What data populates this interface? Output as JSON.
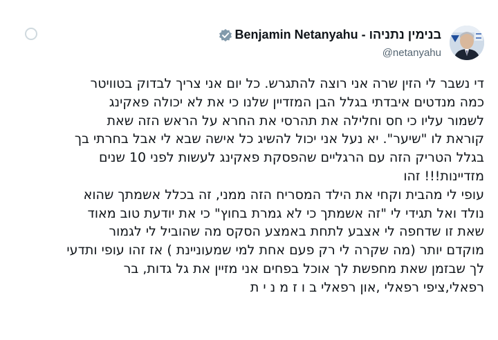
{
  "author": {
    "display_name": "Benjamin Netanyahu - בנימין נתניהו",
    "handle": "@netanyahu",
    "verified_icon": "verified-badge-icon",
    "avatar_icon": "profile-photo"
  },
  "tweet": {
    "lines": [
      "די נשבר לי הזין שרה אני רוצה להתגרש. כל יום אני צריך לבדוק בטוויטר",
      "כמה מנדטים איבדתי בגלל הבן המזדיין שלנו כי את לא יכולה פאקינג",
      "לשמור עליו כי חס וחלילה את תהרסי את החרא על הראש הזה שאת",
      "קוראת לו \"שיער\". יא נעל אני יכול להשיג כל אישה שבא לי אבל בחרתי בך",
      "בגלל הטריק הזה עם הרגליים שהפסקת פאקינג לעשות לפני 10 שנים",
      "מזדיינות!!! זהו",
      "עופי לי מהבית וקחי את הילד המסריח הזה ממני, זה בכלל אשמתך שהוא",
      "נולד ואל תגידי לי \"זה אשמתך כי לא גמרת בחוץ\" כי את יודעת טוב מאוד",
      "שאת זו שדחפה לי אצבע לתחת באמצע הסקס מה שהוביל לי לגמור",
      "מוקדם יותר (מה שקרה לי רק פעם אחת למי שמעוניינת ) אז זהו עופי ותדעי",
      "לך שבזמן שאת מחפשת לך אוכל בפחים אני מזיין את גל גדות, בר",
      "רפאלי,ציפי רפאלי ,און רפאלי ב ו ז מ נ י ת"
    ]
  },
  "colors": {
    "text": "#0f1419",
    "secondary": "#536471",
    "verified": "#829aab"
  }
}
